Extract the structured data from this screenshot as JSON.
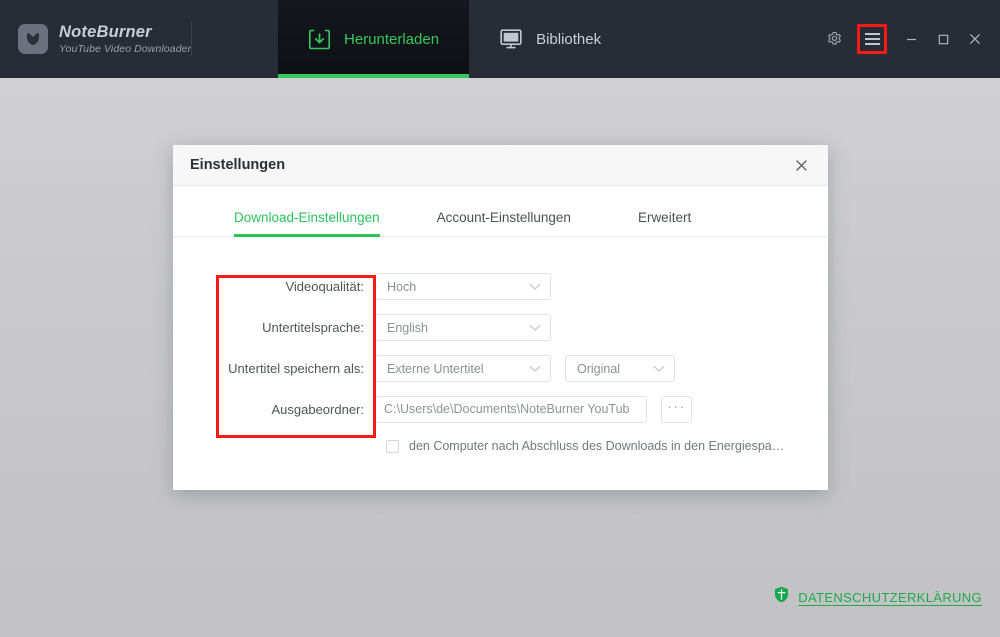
{
  "app": {
    "brand_name": "NoteBurner",
    "brand_sub": "YouTube Video Downloader",
    "logo_icon": "download-badge-icon"
  },
  "nav": {
    "tabs": [
      {
        "label": "Herunterladen",
        "icon": "download-tray-icon",
        "active": true
      },
      {
        "label": "Bibliothek",
        "icon": "monitor-icon",
        "active": false
      }
    ]
  },
  "window_controls": {
    "settings_icon": "gear-icon",
    "menu_icon": "hamburger-menu-icon",
    "minimize_icon": "minimize-icon",
    "maximize_icon": "maximize-icon",
    "close_icon": "close-icon",
    "highlight_color": "#f61b13"
  },
  "dialog": {
    "title": "Einstellungen",
    "close_icon": "close-icon",
    "tabs": [
      {
        "label": "Download-Einstellungen",
        "active": true
      },
      {
        "label": "Account-Einstellungen",
        "active": false
      },
      {
        "label": "Erweitert",
        "active": false
      }
    ],
    "form": {
      "video_quality": {
        "label": "Videoqualität:",
        "value": "Hoch"
      },
      "subtitle_language": {
        "label": "Untertitelsprache:",
        "value": "English"
      },
      "subtitle_save_as": {
        "label": "Untertitel speichern als:",
        "value": "Externe Untertitel",
        "secondary_value": "Original"
      },
      "output_folder": {
        "label": "Ausgabeordner:",
        "value": "C:\\Users\\de\\Documents\\NoteBurner YouTub",
        "browse_label": "···"
      },
      "sleep_checkbox": {
        "label": "den Computer nach Abschluss des Downloads in den Energiespa…",
        "checked": false
      }
    }
  },
  "footer": {
    "privacy_label": "DATENSCHUTZERKLÄRUNG",
    "privacy_icon": "shield-icon"
  },
  "colors": {
    "accent_green": "#2bc25c",
    "topbar_dark": "#272c36",
    "highlight_red": "#f61b13",
    "page_background": "#c8c8ca"
  }
}
